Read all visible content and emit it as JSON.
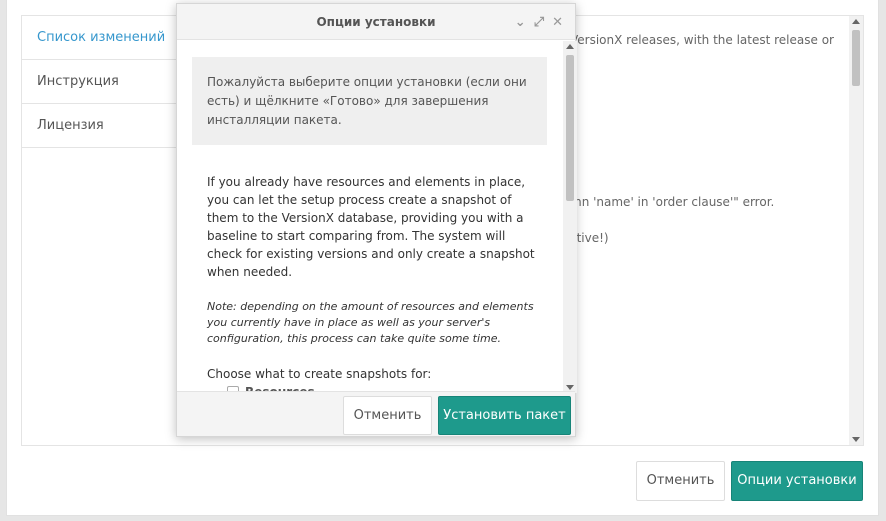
{
  "tabs": [
    {
      "label": "Список изменений",
      "active": true
    },
    {
      "label": "Инструкция",
      "active": false
    },
    {
      "label": "Лицензия",
      "active": false
    }
  ],
  "content": {
    "line1": "VersionX releases, with the latest release or",
    "line2": "mn 'name' in 'order clause'\" error.",
    "line3": "ctive!)"
  },
  "footer": {
    "cancel_label": "Отменить",
    "options_label": "Опции установки"
  },
  "modal": {
    "title": "Опции установки",
    "notice": "Пожалуйста выберите опции установки (если они есть) и щёлкните «Готово» для завершения инсталляции пакета.",
    "intro": "If you already have resources and elements in place, you can let the setup process create a snapshot of them to the VersionX database, providing you with a baseline to start comparing from. The system will check for existing versions and only create a snapshot when needed.",
    "note": "Note: depending on the amount of resources and elements you currently have in place as well as your server's configuration, this process can take quite some time.",
    "choose": "Choose what to create snapshots for:",
    "checkbox_label": "Resources",
    "cancel_label": "Отменить",
    "install_label": "Установить пакет"
  },
  "colors": {
    "accent": "#1e9a8c",
    "active_tab": "#3697cd"
  }
}
